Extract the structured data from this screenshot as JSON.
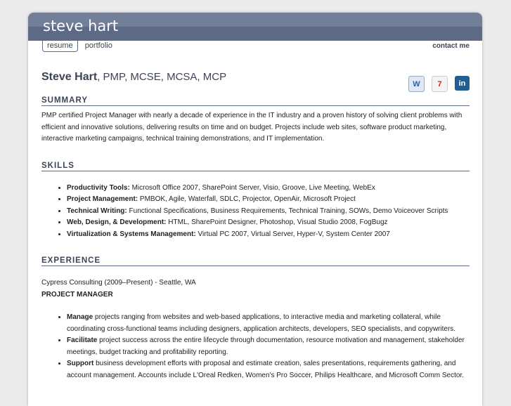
{
  "header": {
    "title": "steve hart"
  },
  "nav": {
    "resume": "resume",
    "portfolio": "portfolio",
    "contact": "contact me"
  },
  "name": {
    "full": "Steve Hart",
    "creds": ", PMP, MCSE, MCSA, MCP"
  },
  "icons": [
    "word-doc-icon",
    "pdf-icon",
    "linkedin-icon"
  ],
  "icon_text": {
    "linkedin": "in"
  },
  "summary": {
    "heading": "SUMMARY",
    "text": "PMP certified Project Manager with nearly a decade of experience in the IT industry and a proven history of solving client problems with efficient and innovative solutions, delivering results on time and on budget. Projects include web sites, software product marketing, interactive marketing campaigns, technical training demonstrations, and IT implementation."
  },
  "skills": {
    "heading": "SKILLS",
    "items": [
      {
        "label": "Productivity Tools:",
        "text": " Microsoft Office 2007, SharePoint Server, Visio, Groove, Live Meeting, WebEx"
      },
      {
        "label": "Project Management:",
        "text": " PMBOK, Agile, Waterfall, SDLC, Projector, OpenAir, Microsoft Project"
      },
      {
        "label": "Technical Writing:",
        "text": " Functional Specifications, Business Requirements, Technical Training, SOWs, Demo Voiceover Scripts"
      },
      {
        "label": "Web, Design, & Development:",
        "text": " HTML, SharePoint Designer, Photoshop, Visual Studio 2008, FogBugz"
      },
      {
        "label": "Virtualization & Systems Management:",
        "text": " Virtual PC 2007, Virtual Server, Hyper-V, System Center 2007"
      }
    ]
  },
  "experience": {
    "heading": "EXPERIENCE",
    "company": "Cypress Consulting (2009–Present) - Seattle, WA",
    "role": "PROJECT MANAGER",
    "items": [
      {
        "label": "Manage",
        "text": " projects ranging from websites and web-based applications, to interactive media and marketing collateral, while coordinating cross-functional teams including designers, application architects, developers, SEO specialists, and copywriters."
      },
      {
        "label": "Facilitate",
        "text": " project success across the entire lifecycle through documentation, resource motivation and management, stakeholder meetings, budget tracking and profitability reporting."
      },
      {
        "label": "Support",
        "text": " business development efforts with proposal and estimate creation, sales presentations, requirements gathering, and account management. Accounts include L'Oreal Redken, Women's Pro Soccer, Philips Healthcare, and Microsoft Comm Sector."
      }
    ]
  }
}
